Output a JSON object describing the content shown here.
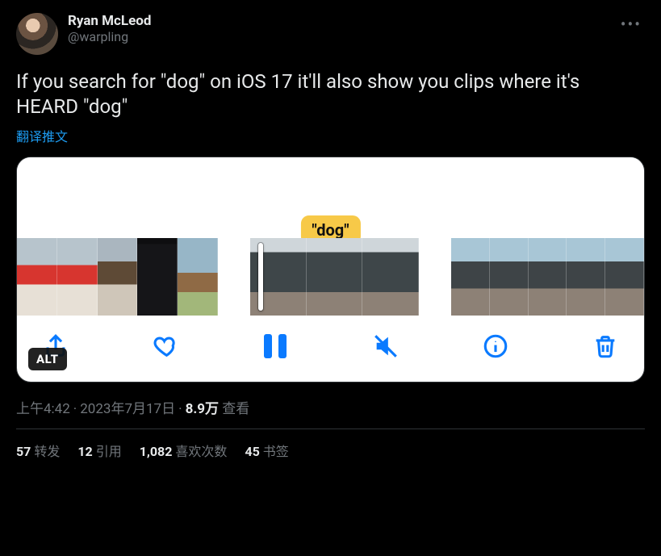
{
  "author": {
    "display_name": "Ryan McLeod",
    "handle": "@warpling"
  },
  "more_label": "•••",
  "body_text": "If you search for \"dog\" on iOS 17 it'll also show you clips where it's HEARD \"dog\"",
  "translate_label": "翻译推文",
  "media": {
    "caption_pill": "\"dog\"",
    "alt_badge": "ALT",
    "toolbar": {
      "share_name": "share-icon",
      "like_name": "heart-icon",
      "pause_name": "pause-icon",
      "mute_name": "mute-icon",
      "info_name": "info-icon",
      "trash_name": "trash-icon"
    }
  },
  "meta": {
    "time": "上午4:42",
    "date": "2023年7月17日",
    "views_number": "8.9万",
    "views_label": "查看"
  },
  "stats": {
    "retweets": {
      "count": "57",
      "label": "转发"
    },
    "quotes": {
      "count": "12",
      "label": "引用"
    },
    "likes": {
      "count": "1,082",
      "label": "喜欢次数"
    },
    "bookmarks": {
      "count": "45",
      "label": "书签"
    }
  }
}
